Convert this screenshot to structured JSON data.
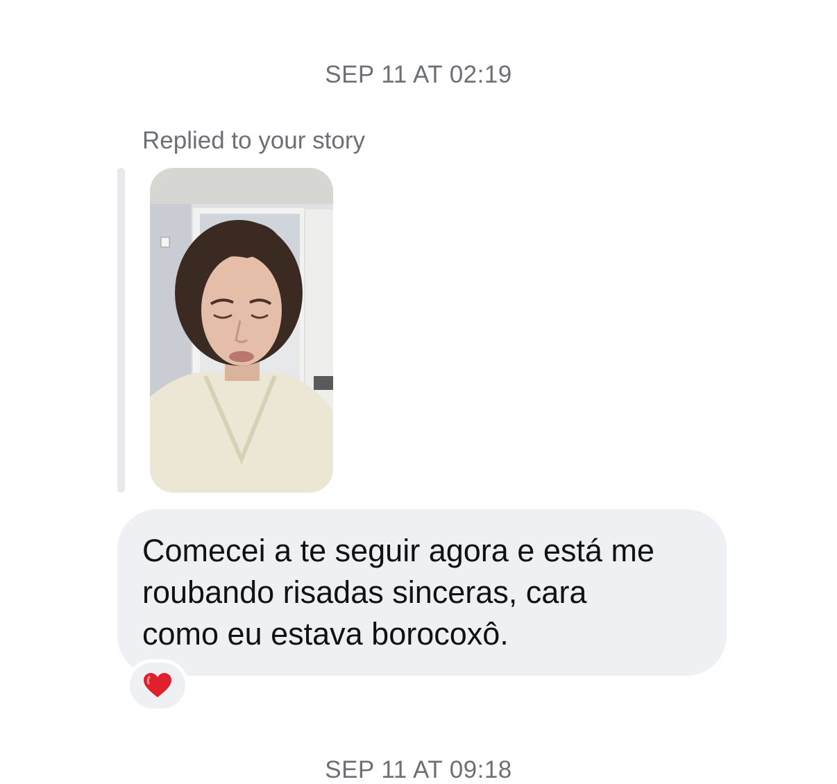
{
  "thread": {
    "timestamp_1": "SEP 11 AT 02:19",
    "timestamp_2": "SEP 11 AT 09:18"
  },
  "story_reply": {
    "label": "Replied to your story",
    "thumbnail_icon": "story-video-thumbnail"
  },
  "message": {
    "text": "Comecei a te seguir agora e está me\nroubando risadas sinceras, cara\ncomo eu estava borocoxô.",
    "reaction_icon": "heart-icon",
    "reaction_color": "#e0202e"
  },
  "colors": {
    "bubble": "#eff0f4",
    "meta_text": "#6c6f76",
    "reply_bar": "#e6e8ec"
  }
}
